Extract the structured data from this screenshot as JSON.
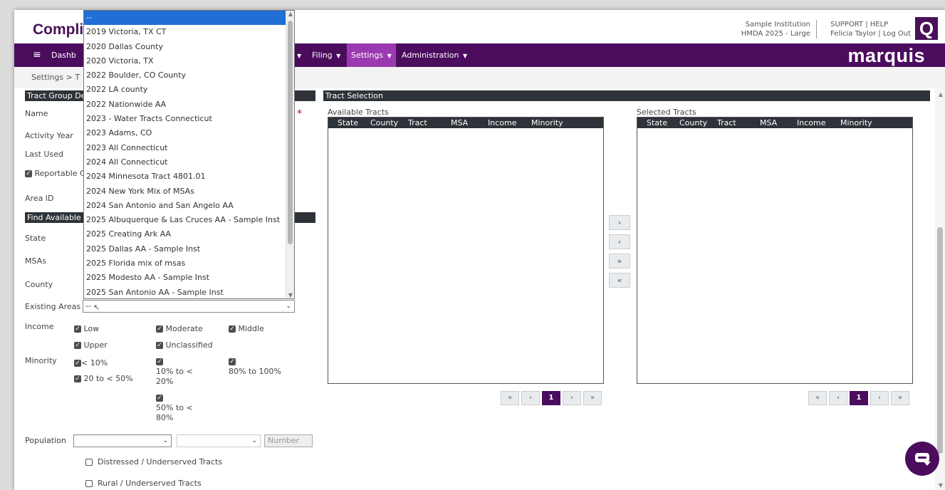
{
  "header": {
    "brand": "Compli",
    "institution": "Sample Institution",
    "filing": "HMDA 2025 - Large",
    "support": "SUPPORT | HELP",
    "user": "Felicia Taylor | Log Out",
    "logo_letter": "Q"
  },
  "nav": {
    "menu_icon": "≡",
    "dashboard": "Dashb",
    "filing": "Filing",
    "settings": "Settings",
    "administration": "Administration",
    "brand_right": "marquis",
    "colors": {
      "nav_bg": "#4b0c5e",
      "active": "#9b3ab0"
    }
  },
  "breadcrumb": "Settings  >  T",
  "tract_group": {
    "section_title": "Tract Group Det",
    "name_label": "Name",
    "activity_year_label": "Activity Year",
    "last_used_label": "Last Used",
    "reportable_label": "Reportable C",
    "area_id_label": "Area ID"
  },
  "find": {
    "section_title": "Find Available T",
    "state_label": "State",
    "msas_label": "MSAs",
    "county_label": "County",
    "existing_areas_label": "Existing Areas",
    "existing_areas_value": "--",
    "income_label": "Income",
    "income_options": [
      "Low",
      "Moderate",
      "Middle",
      "Upper",
      "Unclassified"
    ],
    "minority_label": "Minority",
    "minority_options": [
      "< 10%",
      "10% to <",
      "20%",
      "80% to 100%",
      "20 to < 50%",
      "50% to <",
      "80%"
    ],
    "population_label": "Population",
    "population_number_placeholder": "Number",
    "distressed_label": "Distressed / Underserved Tracts",
    "rural_label": "Rural / Underserved Tracts"
  },
  "dropdown": {
    "items": [
      "--",
      "2019 Victoria, TX CT",
      "2020 Dallas County",
      "2020 Victoria, TX",
      "2022 Boulder, CO County",
      "2022 LA county",
      "2022 Nationwide AA",
      "2023 - Water Tracts Connecticut",
      "2023 Adams, CO",
      "2023 All Connecticut",
      "2024 All Connecticut",
      "2024 Minnesota Tract 4801.01",
      "2024 New York Mix of MSAs",
      "2024 San Antonio and San Angelo AA",
      "2025 Albuquerque & Las Cruces AA - Sample Inst",
      "2025 Creating Ark AA",
      "2025 Dallas AA - Sample Inst",
      "2025 Florida mix of msas",
      "2025 Modesto AA - Sample Inst",
      "2025 San Antonio AA - Sample Inst"
    ]
  },
  "tract_selection": {
    "section_title": "Tract Selection",
    "available_title": "Available Tracts",
    "selected_title": "Selected Tracts",
    "columns": [
      "State",
      "County",
      "Tract",
      "MSA",
      "Income",
      "Minority"
    ],
    "move_buttons": [
      "›",
      "‹",
      "»",
      "«"
    ],
    "pager": [
      "«",
      "‹",
      "1",
      "›",
      "»"
    ]
  }
}
